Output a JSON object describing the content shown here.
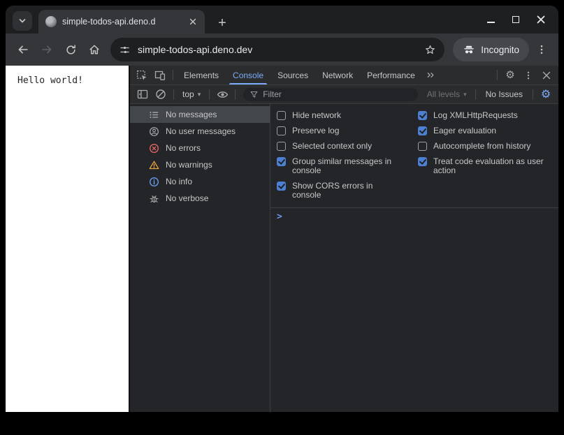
{
  "browser": {
    "tab_title": "simple-todos-api.deno.d",
    "url": "simple-todos-api.deno.dev",
    "incognito_label": "Incognito"
  },
  "page": {
    "body_text": "Hello world!"
  },
  "devtools": {
    "tabs": [
      {
        "label": "Elements",
        "active": false
      },
      {
        "label": "Console",
        "active": true
      },
      {
        "label": "Sources",
        "active": false
      },
      {
        "label": "Network",
        "active": false
      },
      {
        "label": "Performance",
        "active": false
      }
    ],
    "toolbar": {
      "context_selector": "top",
      "filter_placeholder": "Filter",
      "levels_selector": "All levels",
      "issues_label": "No Issues"
    },
    "sidebar": {
      "items": [
        {
          "label": "No messages",
          "icon": "list-icon",
          "selected": true
        },
        {
          "label": "No user messages",
          "icon": "user-icon",
          "selected": false
        },
        {
          "label": "No errors",
          "icon": "error-icon",
          "selected": false
        },
        {
          "label": "No warnings",
          "icon": "warning-icon",
          "selected": false
        },
        {
          "label": "No info",
          "icon": "info-icon",
          "selected": false
        },
        {
          "label": "No verbose",
          "icon": "bug-icon",
          "selected": false
        }
      ]
    },
    "settings": {
      "left": [
        {
          "label": "Hide network",
          "checked": false
        },
        {
          "label": "Preserve log",
          "checked": false
        },
        {
          "label": "Selected context only",
          "checked": false
        },
        {
          "label": "Group similar messages in console",
          "checked": true
        },
        {
          "label": "Show CORS errors in console",
          "checked": true
        }
      ],
      "right": [
        {
          "label": "Log XMLHttpRequests",
          "checked": true
        },
        {
          "label": "Eager evaluation",
          "checked": true
        },
        {
          "label": "Autocomplete from history",
          "checked": false
        },
        {
          "label": "Treat code evaluation as user action",
          "checked": true
        }
      ]
    },
    "prompt_chevron": ">"
  },
  "icons": {
    "gear": "⚙",
    "dropdown_arrow": "▾",
    "new_tab": "+"
  },
  "colors": {
    "accent_blue": "#7cacf8",
    "checkbox_blue": "#4d80d3",
    "error_red": "#e46962",
    "warning_orange": "#e8a33d",
    "info_blue": "#6b9ef0",
    "selection_gray": "#43464a",
    "toolbar_bg": "#35363a",
    "devtools_bg": "#242528"
  }
}
